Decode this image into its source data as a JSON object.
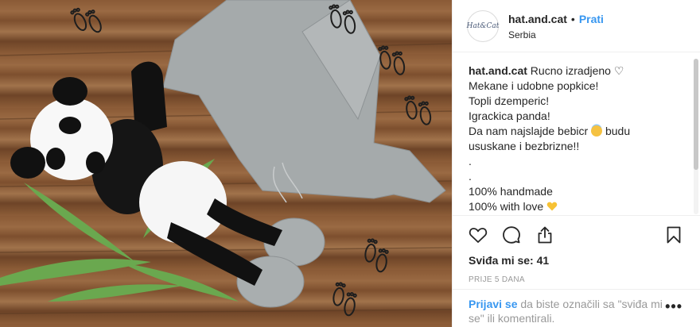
{
  "post": {
    "username": "hat.and.cat",
    "separator": "•",
    "follow_label": "Prati",
    "location": "Serbia",
    "avatar_text": "Hat&Cat"
  },
  "caption": {
    "lines": [
      "Rucno izradjeno ♡",
      "Mekane i udobne popkice!",
      "Topli dzemperic!",
      "Igrackica panda!",
      "Da nam najslajde bebicr",
      "ususkane i bezbrizne!!",
      ".",
      ".",
      "100% handmade",
      "100% with love",
      "."
    ],
    "line5_suffix": "budu"
  },
  "icons": {
    "like": "heart-outline-icon",
    "comment": "comment-bubble-icon",
    "share": "share-upload-icon",
    "save": "bookmark-icon",
    "more": "more-dots-icon",
    "emoji_halo": "smiling-face-with-halo",
    "emoji_heart": "yellow-heart"
  },
  "likes": {
    "text": "Sviđa mi se: 41"
  },
  "time": {
    "text": "PRIJE 5 DANA"
  },
  "login": {
    "link": "Prijavi se",
    "rest": " da biste označili sa \"sviđa mi se\" ili komentirali.",
    "more": "•••"
  },
  "colors": {
    "link": "#3897f0",
    "text": "#262626",
    "muted": "#999999",
    "border": "#efefef"
  }
}
